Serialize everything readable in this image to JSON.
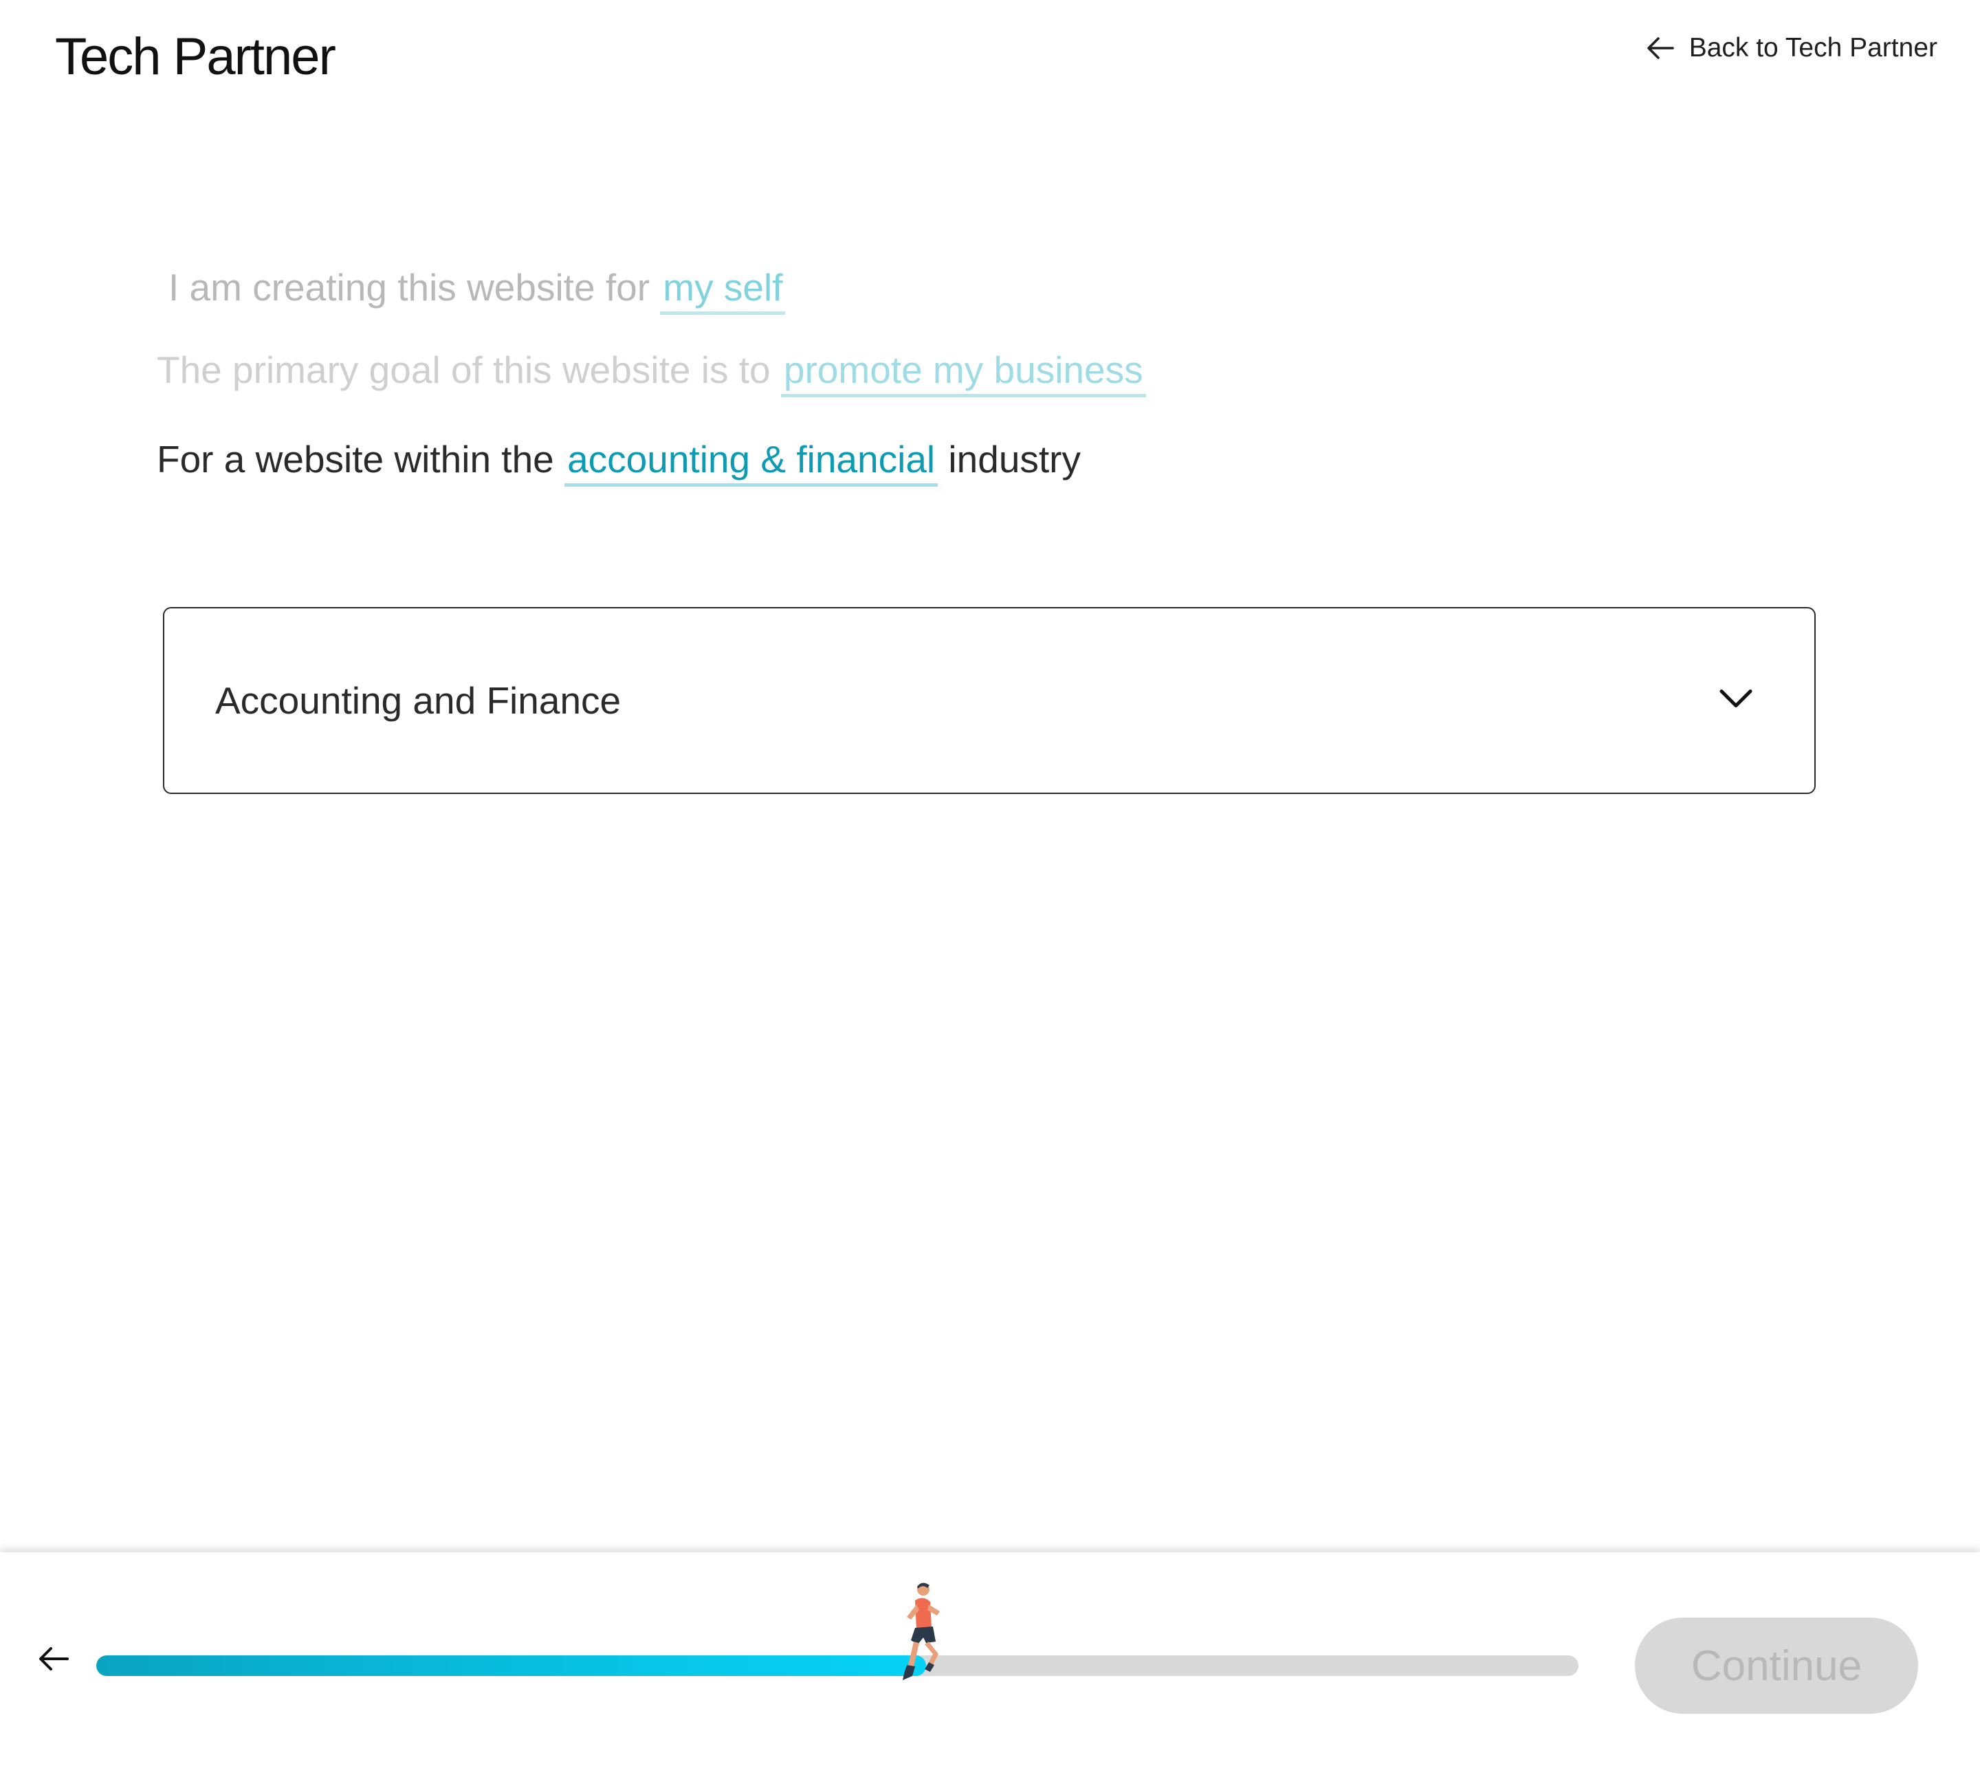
{
  "header": {
    "logo": "Tech Partner",
    "back_link": "Back to Tech Partner"
  },
  "statements": [
    {
      "prefix": "I am creating this website for",
      "answer": "my self",
      "suffix": ""
    },
    {
      "prefix": "The primary goal of this website is to",
      "answer": "promote my business",
      "suffix": ""
    },
    {
      "prefix": "For a website within the",
      "answer": "accounting & financial",
      "suffix": "industry"
    }
  ],
  "industry_select": {
    "value": "Accounting and Finance"
  },
  "footer": {
    "progress_fraction": 0.56,
    "continue_label": "Continue"
  },
  "colors": {
    "accent": "#0d9bb3",
    "progress_start": "#0aa4c2",
    "progress_end": "#05d2f6",
    "disabled_button": "#d8d8d8"
  },
  "icons": {
    "back": "arrow-left-icon",
    "chevron": "chevron-down-icon",
    "runner": "runner-icon"
  }
}
